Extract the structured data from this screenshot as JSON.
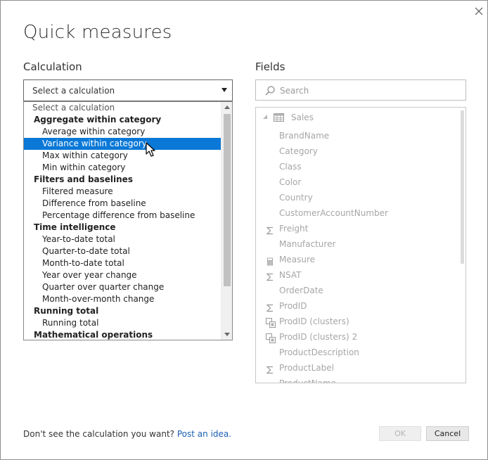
{
  "dialog": {
    "title": "Quick measures",
    "close_icon": "close-icon"
  },
  "calculation": {
    "label": "Calculation",
    "selected_value": "Select a calculation",
    "options": [
      {
        "kind": "placeholder",
        "label": "Select a calculation"
      },
      {
        "kind": "header",
        "label": "Aggregate within category"
      },
      {
        "kind": "option",
        "label": "Average within category"
      },
      {
        "kind": "option",
        "label": "Variance within category",
        "selected": true
      },
      {
        "kind": "option",
        "label": "Max within category"
      },
      {
        "kind": "option",
        "label": "Min within category"
      },
      {
        "kind": "header",
        "label": "Filters and baselines"
      },
      {
        "kind": "option",
        "label": "Filtered measure"
      },
      {
        "kind": "option",
        "label": "Difference from baseline"
      },
      {
        "kind": "option",
        "label": "Percentage difference from baseline"
      },
      {
        "kind": "header",
        "label": "Time intelligence"
      },
      {
        "kind": "option",
        "label": "Year-to-date total"
      },
      {
        "kind": "option",
        "label": "Quarter-to-date total"
      },
      {
        "kind": "option",
        "label": "Month-to-date total"
      },
      {
        "kind": "option",
        "label": "Year over year change"
      },
      {
        "kind": "option",
        "label": "Quarter over quarter change"
      },
      {
        "kind": "option",
        "label": "Month-over-month change"
      },
      {
        "kind": "header",
        "label": "Running total"
      },
      {
        "kind": "option",
        "label": "Running total"
      },
      {
        "kind": "header",
        "label": "Mathematical operations"
      }
    ],
    "accent_color": "#0a78d7"
  },
  "fields": {
    "label": "Fields",
    "search_placeholder": "Search",
    "table": {
      "name": "Sales",
      "icon": "table-icon"
    },
    "items": [
      {
        "name": "BrandName",
        "icon": ""
      },
      {
        "name": "Category",
        "icon": ""
      },
      {
        "name": "Class",
        "icon": ""
      },
      {
        "name": "Color",
        "icon": ""
      },
      {
        "name": "Country",
        "icon": ""
      },
      {
        "name": "CustomerAccountNumber",
        "icon": ""
      },
      {
        "name": "Freight",
        "icon": "sigma-icon"
      },
      {
        "name": "Manufacturer",
        "icon": ""
      },
      {
        "name": "Measure",
        "icon": "calculator-icon"
      },
      {
        "name": "NSAT",
        "icon": "sigma-icon"
      },
      {
        "name": "OrderDate",
        "icon": ""
      },
      {
        "name": "ProdID",
        "icon": "sigma-icon"
      },
      {
        "name": "ProdID (clusters)",
        "icon": "cluster-icon"
      },
      {
        "name": "ProdID (clusters) 2",
        "icon": "cluster-icon"
      },
      {
        "name": "ProductDescription",
        "icon": ""
      },
      {
        "name": "ProductLabel",
        "icon": "sigma-icon"
      },
      {
        "name": "ProductName",
        "icon": ""
      }
    ]
  },
  "footer": {
    "prompt": "Don't see the calculation you want?",
    "link": "Post an idea.",
    "ok_label": "OK",
    "cancel_label": "Cancel"
  }
}
